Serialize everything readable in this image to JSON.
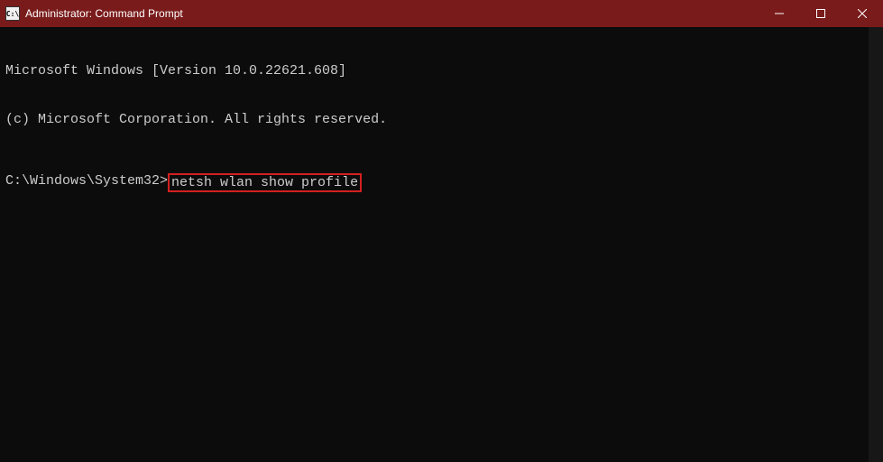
{
  "titlebar": {
    "icon_label": "C:\\",
    "title": "Administrator: Command Prompt"
  },
  "terminal": {
    "line1": "Microsoft Windows [Version 10.0.22621.608]",
    "line2": "(c) Microsoft Corporation. All rights reserved.",
    "prompt": "C:\\Windows\\System32>",
    "command": "netsh wlan show profile"
  },
  "colors": {
    "titlebar_bg": "#7a1b1b",
    "terminal_bg": "#0c0c0c",
    "text": "#cccccc",
    "highlight_border": "#d41f1f"
  }
}
